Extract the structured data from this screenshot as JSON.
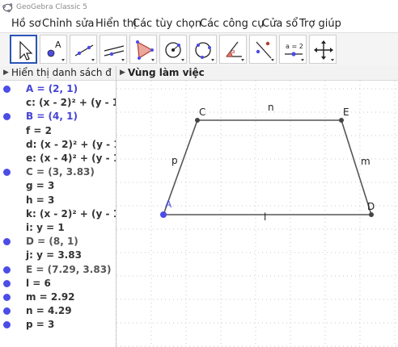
{
  "window": {
    "title": "GeoGebra Classic 5"
  },
  "menu": [
    "Hồ sơ",
    "Chỉnh sửa",
    "Hiển thị",
    "Các tùy chọn",
    "Các công cụ",
    "Cửa sổ",
    "Trợ giúp"
  ],
  "toolbar": {
    "tools": [
      {
        "icon": "move-arrow-icon",
        "selected": true
      },
      {
        "icon": "new-point-icon"
      },
      {
        "icon": "line-icon"
      },
      {
        "icon": "perpendicular-line-icon"
      },
      {
        "icon": "polygon-icon"
      },
      {
        "icon": "circle-center-point-icon"
      },
      {
        "icon": "circle-three-points-icon"
      },
      {
        "icon": "angle-icon"
      },
      {
        "icon": "reflect-about-line-icon"
      },
      {
        "icon": "slider-icon",
        "label": "a = 2"
      },
      {
        "icon": "move-graphics-view-icon"
      }
    ]
  },
  "algebra": {
    "header": "Hiển thị danh sách đ",
    "rows": [
      {
        "text": "A = (2, 1)",
        "dot": true,
        "style": "blue"
      },
      {
        "text": "c: (x - 2)² + (y - 1)",
        "dot": false,
        "style": "dark"
      },
      {
        "text": "B = (4, 1)",
        "dot": true,
        "style": "blue"
      },
      {
        "text": "f = 2",
        "dot": false,
        "style": "dark"
      },
      {
        "text": "d: (x - 2)² + (y - 1)",
        "dot": false,
        "style": "dark"
      },
      {
        "text": "e: (x - 4)² + (y - 1)",
        "dot": false,
        "style": "dark"
      },
      {
        "text": "C = (3, 3.83)",
        "dot": true,
        "style": "grey"
      },
      {
        "text": "g = 3",
        "dot": false,
        "style": "dark"
      },
      {
        "text": "h = 3",
        "dot": false,
        "style": "dark"
      },
      {
        "text": "k: (x - 2)² + (y - 1)",
        "dot": false,
        "style": "dark"
      },
      {
        "text": "i: y = 1",
        "dot": false,
        "style": "dark"
      },
      {
        "text": "D = (8, 1)",
        "dot": true,
        "style": "grey"
      },
      {
        "text": "j: y = 3.83",
        "dot": false,
        "style": "dark"
      },
      {
        "text": "E = (7.29, 3.83)",
        "dot": true,
        "style": "grey"
      },
      {
        "text": "l = 6",
        "dot": true,
        "style": "dark"
      },
      {
        "text": "m = 2.92",
        "dot": true,
        "style": "dark"
      },
      {
        "text": "n = 4.29",
        "dot": true,
        "style": "dark"
      },
      {
        "text": "p = 3",
        "dot": true,
        "style": "dark"
      }
    ]
  },
  "graphics": {
    "header": "Vùng làm việc",
    "labels": {
      "A": "A",
      "C": "C",
      "E": "E",
      "D": "D",
      "n": "n",
      "p": "p",
      "m": "m",
      "l": "l"
    },
    "colors": {
      "point_A": "#4c4ce6",
      "point": "#444444",
      "segment": "#555555",
      "grid": "#c8c8c8"
    }
  }
}
